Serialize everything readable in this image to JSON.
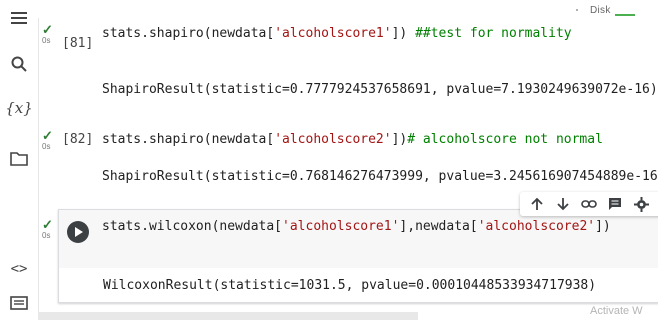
{
  "topbar": {
    "disk_label": "Disk"
  },
  "sidebar": {
    "items": [
      {
        "name": "table-of-contents",
        "icon": "menu-icon"
      },
      {
        "name": "search",
        "icon": "search-icon"
      },
      {
        "name": "variables",
        "icon": "variables-icon",
        "glyph": "{x}"
      },
      {
        "name": "files",
        "icon": "folder-icon"
      },
      {
        "name": "code-snippets",
        "icon": "code-icon",
        "glyph": "<>"
      },
      {
        "name": "terminal",
        "icon": "terminal-icon"
      }
    ]
  },
  "cells": [
    {
      "exec_count": "[81]",
      "status_time": "0s",
      "code_prefix": "stats.shapiro(newdata[",
      "code_str": "'alcoholscore1'",
      "code_suffix": "]) ",
      "code_comment": "##test for normality",
      "output": "ShapiroResult(statistic=0.7777924537658691, pvalue=7.1930249639072e-16)"
    },
    {
      "exec_count": "[82]",
      "status_time": "0s",
      "code_prefix": "stats.shapiro(newdata[",
      "code_str": "'alcoholscore2'",
      "code_suffix": "])",
      "code_comment": "# alcoholscore not normal",
      "output": "ShapiroResult(statistic=0.768146276473999, pvalue=3.245616907454889e-16)"
    },
    {
      "status_time": "0s",
      "code_prefix": "stats.wilcoxon(newdata[",
      "code_str1": "'alcoholscore1'",
      "code_mid": "],newdata[",
      "code_str2": "'alcoholscore2'",
      "code_suffix": "])",
      "output": "WilcoxonResult(statistic=1031.5, pvalue=0.00010448533934717938)"
    }
  ],
  "cell_toolbar": {
    "icons": [
      "arrow-up-icon",
      "arrow-down-icon",
      "link-icon",
      "comment-icon",
      "settings-icon"
    ]
  },
  "watermark": {
    "text": "Activate W"
  }
}
